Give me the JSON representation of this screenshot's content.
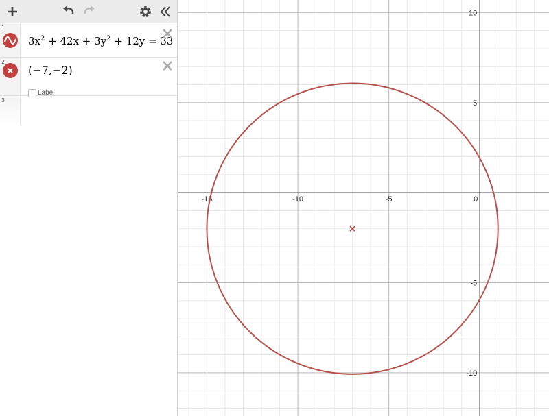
{
  "toolbar": {
    "add_icon": "plus-icon",
    "undo_icon": "undo-icon",
    "redo_icon": "redo-icon",
    "settings_icon": "gear-icon",
    "collapse_icon": "double-chevron-left-icon"
  },
  "expressions": [
    {
      "index": "1",
      "latex_parts": {
        "a": "3x",
        "b": "2",
        "c": " + 42x + 3y",
        "d": "2",
        "e": " + 12y = 33"
      },
      "icon": "curve-icon",
      "color": "#c0413f"
    },
    {
      "index": "2",
      "text": "(−7,−2)",
      "icon": "point-icon",
      "color": "#c0413f",
      "label_checkbox": "Label"
    },
    {
      "index": "3"
    }
  ],
  "graph": {
    "x_ticks": [
      "-15",
      "-10",
      "-5",
      "0"
    ],
    "y_ticks": [
      "10",
      "5",
      "-5",
      "-10"
    ],
    "curve_color": "#b5514a",
    "circle": {
      "center": [
        -7,
        -2
      ],
      "radius": 8
    },
    "point": [
      -7,
      -2
    ],
    "x_range": [
      -16.6,
      3.8
    ],
    "y_range": [
      -12.4,
      10.7
    ]
  }
}
